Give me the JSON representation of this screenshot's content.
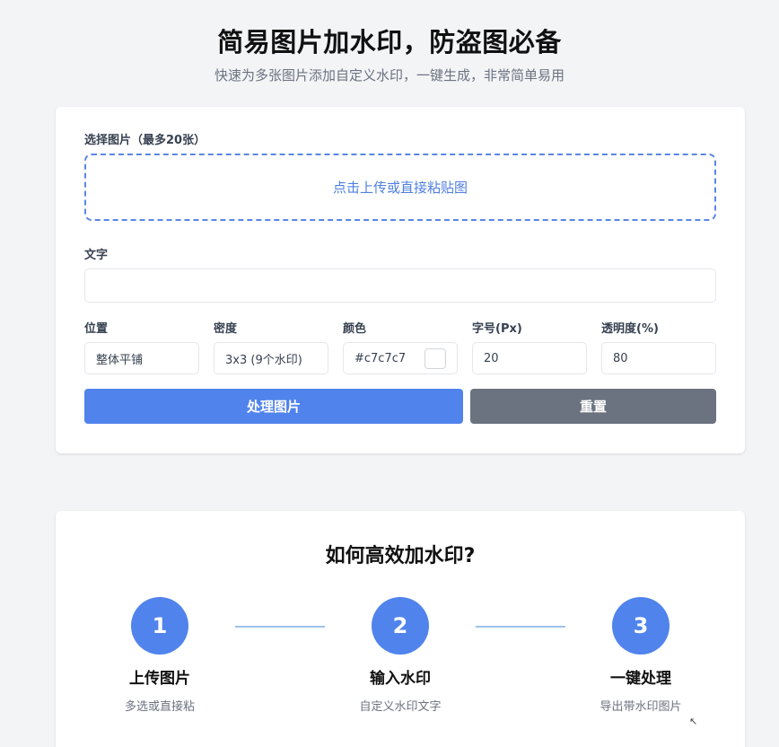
{
  "hero": {
    "title": "简易图片加水印，防盗图必备",
    "subtitle": "快速为多张图片添加自定义水印，一键生成，非常简单易用"
  },
  "form": {
    "upload_label": "选择图片（最多20张）",
    "upload_prompt": "点击上传或直接粘贴图",
    "text_label": "文字",
    "text_value": "",
    "position_label": "位置",
    "position_value": "整体平铺",
    "density_label": "密度",
    "density_value": "3x3 (9个水印)",
    "color_label": "颜色",
    "color_value": "#c7c7c7",
    "size_label": "字号(Px)",
    "size_value": "20",
    "opacity_label": "透明度(%)",
    "opacity_value": "80",
    "process_button": "处理图片",
    "reset_button": "重置"
  },
  "how": {
    "title": "如何高效加水印?",
    "steps": [
      {
        "number": "1",
        "title": "上传图片",
        "desc": "多选或直接粘"
      },
      {
        "number": "2",
        "title": "输入水印",
        "desc": "自定义水印文字"
      },
      {
        "number": "3",
        "title": "一键处理",
        "desc": "导出带水印图片"
      }
    ]
  },
  "colors": {
    "accent": "#5083ec",
    "secondary": "#6b7280",
    "connector": "#9ec3ea"
  }
}
